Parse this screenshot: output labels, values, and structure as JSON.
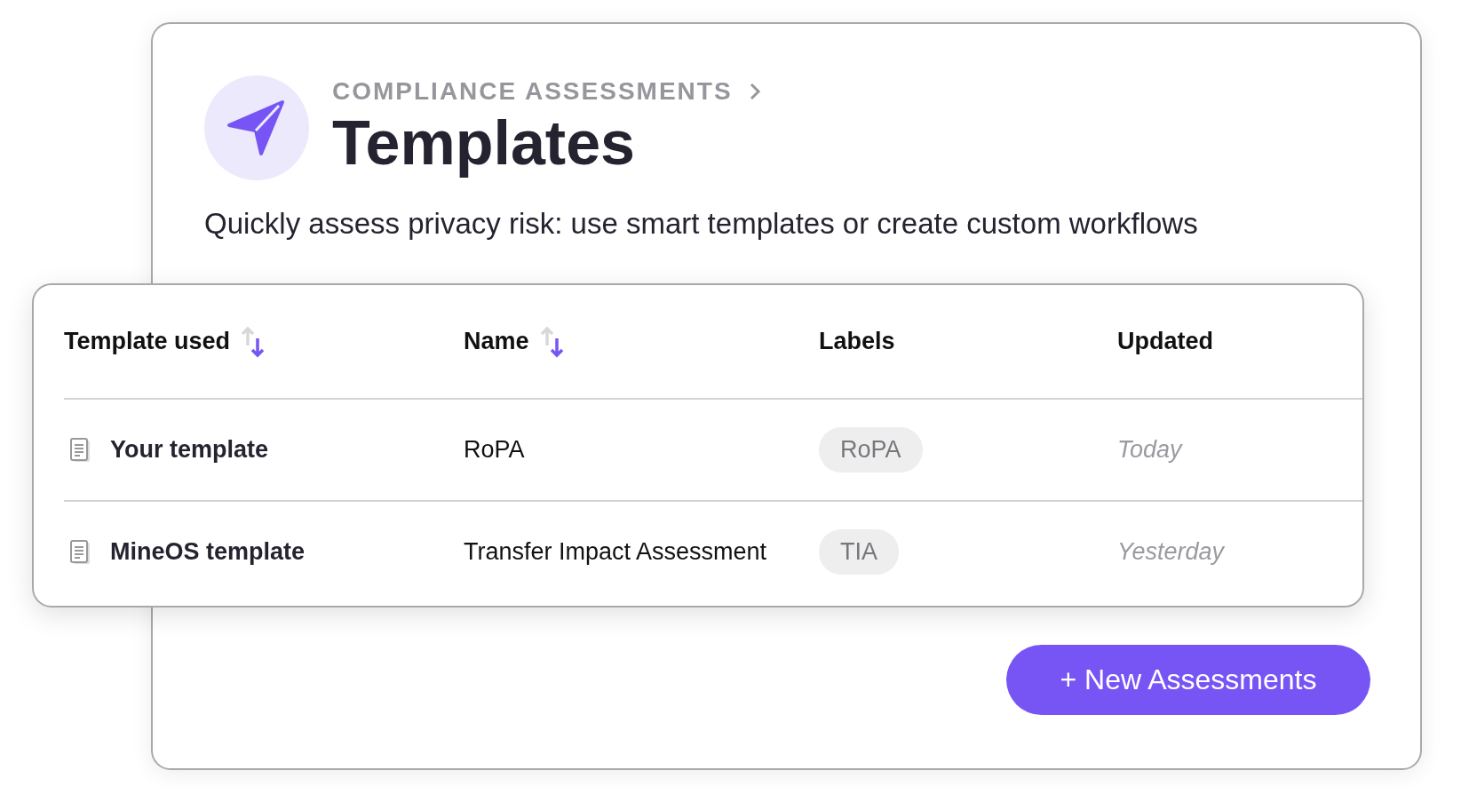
{
  "header": {
    "breadcrumb": "COMPLIANCE ASSESSMENTS",
    "title": "Templates",
    "subtitle": "Quickly assess privacy risk: use smart templates or create custom workflows"
  },
  "table": {
    "columns": [
      {
        "label": "Template used",
        "sortable": true,
        "descending": true
      },
      {
        "label": "Name",
        "sortable": true,
        "descending": true
      },
      {
        "label": "Labels",
        "sortable": false
      },
      {
        "label": "Updated",
        "sortable": false
      }
    ],
    "rows": [
      {
        "template": "Your template",
        "name": "RoPA",
        "label": "RoPA",
        "updated": "Today"
      },
      {
        "template": "MineOS template",
        "name": "Transfer Impact Assessment",
        "label": "TIA",
        "updated": "Yesterday"
      }
    ]
  },
  "button": "+ New Assessments"
}
